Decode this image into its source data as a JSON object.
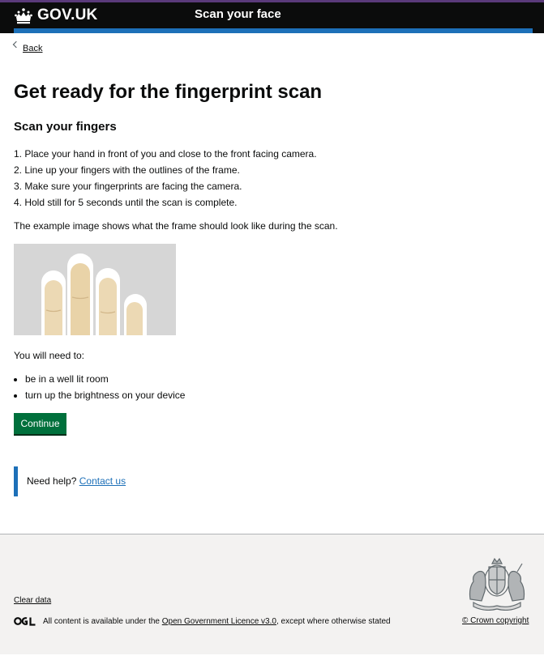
{
  "header": {
    "logo_text": "GOV.UK",
    "service_name": "Scan your face"
  },
  "nav": {
    "back_label": "Back"
  },
  "main": {
    "title": "Get ready for the fingerprint scan",
    "subtitle": "Scan your fingers",
    "steps": [
      "1. Place your hand in front of you and close to the front facing camera.",
      "2. Line up your fingers with the outlines of the frame.",
      "3. Make sure your fingerprints are facing the camera.",
      "4. Hold still for 5 seconds until the scan is complete."
    ],
    "intro": "The example image shows what the frame should look like during the scan.",
    "need_label": "You will need to:",
    "needs": [
      "be in a well lit room",
      "turn up the brightness on your device"
    ],
    "continue_label": "Continue"
  },
  "help": {
    "prefix": "Need help?",
    "link_label": "Contact us"
  },
  "footer": {
    "clear_data": "Clear data",
    "licence_prefix": "All content is available under the",
    "licence_link": "Open Government Licence v3.0",
    "licence_suffix": ", except where otherwise stated",
    "copyright": "© Crown copyright"
  },
  "colors": {
    "header_bg": "#0b0c0c",
    "brand_blue": "#1d70b8",
    "button_green": "#00703c",
    "footer_bg": "#f3f2f1"
  }
}
